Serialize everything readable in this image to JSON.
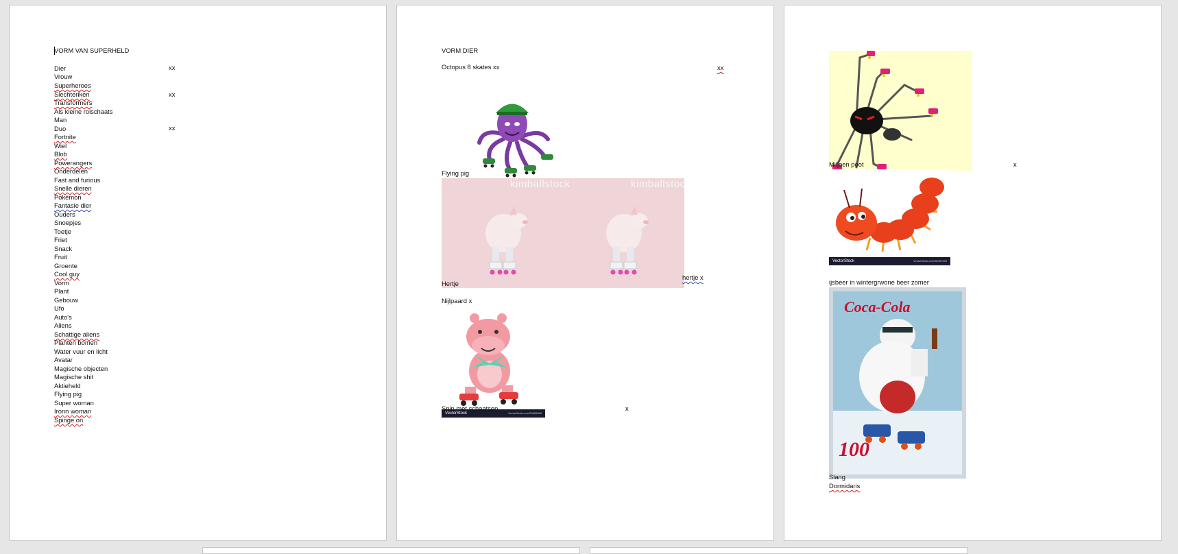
{
  "page1": {
    "title": "VORM VAN SUPERHELD",
    "items": [
      "Dier",
      "Vrouw",
      "Superheroes",
      "Slechteriken",
      "Transformers",
      "Als kleine rolschaats",
      "Man",
      "Duo",
      "Fortnite",
      "Wiel",
      "Blob",
      "Powerangers",
      "Onderdelen",
      "Fast and furious",
      "Snelle dieren",
      "Pokémon",
      "Fantasie dier",
      "Ouders",
      "Snoepjes",
      "Toetje",
      "Friet",
      "Snack",
      "Fruit",
      "Groente",
      "Cool guy",
      "Vorm",
      "Plant",
      "Gebouw",
      "Ufo",
      "Auto's",
      "Aliens",
      "Schattige aliens",
      "Planten bomen",
      "Water vuur en licht",
      "Avatar",
      "Magische objecten",
      "Magische shit",
      "Aktieheld",
      "Flying pig",
      "Super woman",
      "Ironn woman",
      "Spinge on"
    ],
    "marks": [
      "xx",
      "xx",
      "xx"
    ]
  },
  "page2": {
    "title": "VORM DIER",
    "octopus_line": "Octopus 8 skates xx",
    "octopus_mark": "xx",
    "flying_pig": "Flying pig",
    "hertje_side": "hertje x",
    "hertje": "Hertje",
    "nijlpaard": "Nijlpaard x",
    "spin": "Spin met schaatsen",
    "spin_mark": "x",
    "watermark": "kimballstock",
    "vectorstock_brand": "VectorStock",
    "vectorstock_url": "VectorStock.com/20669098"
  },
  "page3": {
    "miljoen": "Miljoen poot",
    "miljoen_mark": "x",
    "ijsbeer": "ijsbeer in wintergrwone beer zomer",
    "slang": "Slang",
    "dormidaris": "Dormidaris",
    "vectorstock_brand": "VectorStock",
    "vectorstock_url": "VectorStock.com/30497339",
    "coca_cola": "Coca-Cola",
    "coca_number": "100"
  },
  "colors": {
    "page": "#ffffff",
    "background": "#e6e6e6",
    "spell_underline": "#d02020",
    "grammar_underline": "#2a4fc0",
    "pig_bg": "#efd5d8",
    "spider_bg": "#fffecd"
  }
}
